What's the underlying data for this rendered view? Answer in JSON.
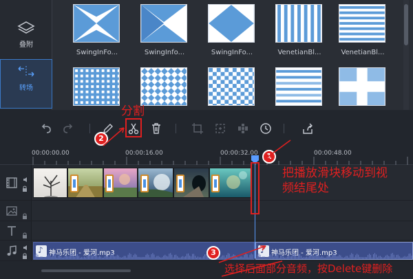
{
  "nav": {
    "overlay_label": "叠附",
    "transition_label": "转场"
  },
  "transitions": [
    {
      "name": "SwingInFo..."
    },
    {
      "name": "SwingInfo..."
    },
    {
      "name": "SwingInFo..."
    },
    {
      "name": "VenetianBl..."
    },
    {
      "name": "VenetianBl..."
    },
    {
      "name": ""
    },
    {
      "name": ""
    },
    {
      "name": ""
    },
    {
      "name": ""
    },
    {
      "name": ""
    }
  ],
  "toolbar": {
    "undo": "undo-icon",
    "redo": "redo-icon",
    "edit": "pencil-icon",
    "split": "scissors-icon",
    "delete": "trash-icon",
    "crop": "crop-icon",
    "zoom": "zoom-icon",
    "mosaic": "mosaic-icon",
    "duration": "clock-icon",
    "export": "share-icon"
  },
  "ruler": {
    "ticks": [
      "00:00:00.00",
      "00:00:16.00",
      "00:00:32.00",
      "00:00:48.00"
    ]
  },
  "audio": {
    "clip1": "神马乐团 - 爱河.mp3",
    "clip2": "神马乐团 - 爱河.mp3"
  },
  "annotations": {
    "split_label": "分割",
    "step1_num": "1",
    "step2_num": "2",
    "step3_num": "3",
    "step1_text_line1": "把播放滑块移动到视",
    "step1_text_line2": "频结尾处",
    "step3_text": "选择后面部分音频，按Delete键删除"
  },
  "colors": {
    "accent": "#5a9cff",
    "annotation_red": "#e02020",
    "audio_clip": "#3c4d8a"
  }
}
